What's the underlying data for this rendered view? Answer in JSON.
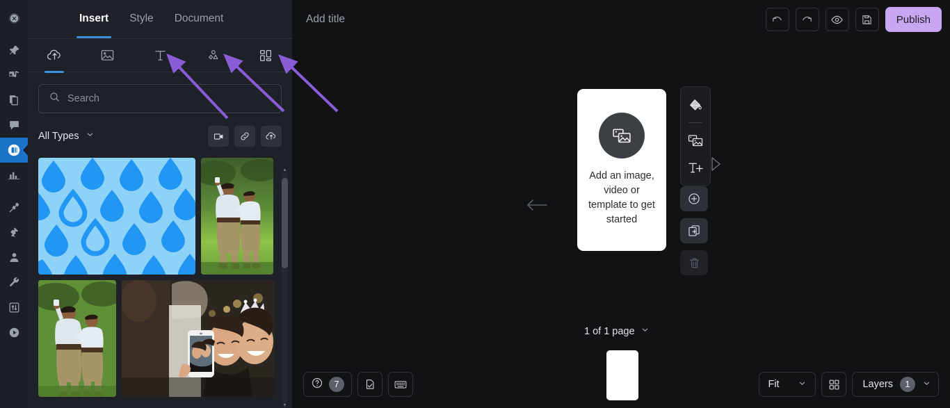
{
  "app": {
    "accent_blue": "#3d8fe0",
    "active_rail_blue": "#1a73c8",
    "publish_purple": "#c9a6f2",
    "annotation_purple": "#8a5cd6",
    "panel_bg": "#1e2127",
    "canvas_bg": "#111214",
    "rail_bg": "#1c1f26"
  },
  "rail": {
    "items": [
      {
        "name": "dashboard-icon",
        "label": "Dashboard",
        "active": false
      },
      {
        "name": "pin-icon",
        "label": "Pin",
        "active": false
      },
      {
        "name": "audio-icon",
        "label": "Audio",
        "active": false
      },
      {
        "name": "pages-icon",
        "label": "Pages",
        "active": false
      },
      {
        "name": "comment-icon",
        "label": "Comments",
        "active": false
      },
      {
        "name": "slides-icon",
        "label": "Slides",
        "active": true
      },
      {
        "name": "chart-icon",
        "label": "Charts",
        "active": false
      },
      {
        "name": "hammer-icon",
        "label": "Build",
        "active": false
      },
      {
        "name": "plug-icon",
        "label": "Integrations",
        "active": false
      },
      {
        "name": "user-icon",
        "label": "Account",
        "active": false
      },
      {
        "name": "wrench-icon",
        "label": "Settings",
        "active": false
      },
      {
        "name": "sliders-icon",
        "label": "Controls",
        "active": false
      },
      {
        "name": "play-icon",
        "label": "Play",
        "active": false
      }
    ]
  },
  "panel": {
    "tabs": [
      {
        "label": "Insert",
        "active": true
      },
      {
        "label": "Style",
        "active": false
      },
      {
        "label": "Document",
        "active": false
      }
    ],
    "icon_tabs": [
      {
        "name": "upload-cloud-icon",
        "label": "Upload",
        "selected": true
      },
      {
        "name": "image-icon",
        "label": "Media",
        "selected": false
      },
      {
        "name": "text-icon",
        "label": "Text",
        "selected": false
      },
      {
        "name": "shapes-icon",
        "label": "Shapes",
        "selected": false
      },
      {
        "name": "elements-grid-icon",
        "label": "Elements",
        "selected": false
      }
    ],
    "search": {
      "placeholder": "Search",
      "value": ""
    },
    "filter": {
      "label": "All Types",
      "buttons": [
        {
          "name": "video-icon",
          "label": "Record video"
        },
        {
          "name": "link-icon",
          "label": "Add from link"
        },
        {
          "name": "upload-cloud-icon",
          "label": "Upload file"
        }
      ]
    },
    "thumbnails": [
      {
        "name": "raindrop-pattern-thumbnail",
        "label": "Blue raindrop pattern",
        "kind": "pattern"
      },
      {
        "name": "photo-thumbnail-father-son",
        "label": "Man and boy taking selfie in field",
        "kind": "photo"
      },
      {
        "name": "photo-thumbnail-father-son-2",
        "label": "Man and boy taking selfie in field",
        "kind": "photo"
      },
      {
        "name": "photo-thumbnail-party-selfie",
        "label": "Two women selfie at party",
        "kind": "photo"
      }
    ]
  },
  "topbar": {
    "title_placeholder": "Add title",
    "title_value": "",
    "actions": [
      {
        "name": "undo-button",
        "label": "Undo"
      },
      {
        "name": "redo-button",
        "label": "Redo"
      },
      {
        "name": "preview-button",
        "label": "Preview"
      },
      {
        "name": "save-button",
        "label": "Save"
      }
    ],
    "publish_label": "Publish"
  },
  "canvas": {
    "placeholder_text": "Add an image, video or template to get started",
    "back_arrow_label": "Previous page",
    "float_tools": [
      {
        "name": "fill-color-icon",
        "label": "Fill color"
      },
      {
        "name": "media-icon",
        "label": "Add media"
      },
      {
        "name": "add-text-icon",
        "label": "Add text"
      }
    ],
    "page_tools": [
      {
        "name": "add-page-icon",
        "label": "Add page",
        "disabled": false
      },
      {
        "name": "duplicate-page-icon",
        "label": "Duplicate page",
        "disabled": false
      },
      {
        "name": "delete-page-icon",
        "label": "Delete page",
        "disabled": true
      }
    ],
    "page_indicator": "1 of 1 page"
  },
  "bottom": {
    "help": {
      "name": "help-button",
      "label": "Help",
      "badge": "7"
    },
    "buttons": [
      {
        "name": "page-check-button",
        "label": "Page check"
      },
      {
        "name": "keyboard-shortcuts-button",
        "label": "Keyboard shortcuts"
      }
    ],
    "zoom_label": "Fit",
    "grid_label": "Grid view",
    "layers_label": "Layers",
    "layers_count": "1"
  },
  "annotations": {
    "arrows": [
      {
        "name": "arrow-to-text-tool",
        "target": "Text"
      },
      {
        "name": "arrow-to-shapes-tool",
        "target": "Shapes"
      },
      {
        "name": "arrow-to-elements-tool",
        "target": "Elements"
      }
    ]
  }
}
